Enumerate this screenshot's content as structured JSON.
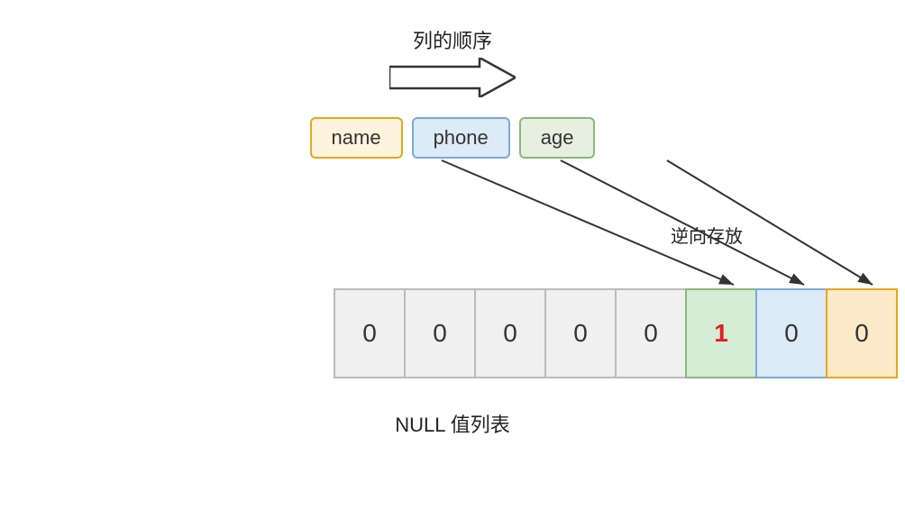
{
  "header": {
    "arrow_label": "列的顺序",
    "reverse_label": "逆向存放"
  },
  "columns": [
    {
      "id": "name",
      "label": "name",
      "style": "col-name"
    },
    {
      "id": "phone",
      "label": "phone",
      "style": "col-phone"
    },
    {
      "id": "age",
      "label": "age",
      "style": "col-age"
    }
  ],
  "cells": [
    {
      "value": "0",
      "style": "normal"
    },
    {
      "value": "0",
      "style": "normal"
    },
    {
      "value": "0",
      "style": "normal"
    },
    {
      "value": "0",
      "style": "normal"
    },
    {
      "value": "0",
      "style": "normal"
    },
    {
      "value": "1",
      "style": "green"
    },
    {
      "value": "0",
      "style": "blue"
    },
    {
      "value": "0",
      "style": "orange"
    }
  ],
  "footer": {
    "label": "NULL 值列表"
  }
}
